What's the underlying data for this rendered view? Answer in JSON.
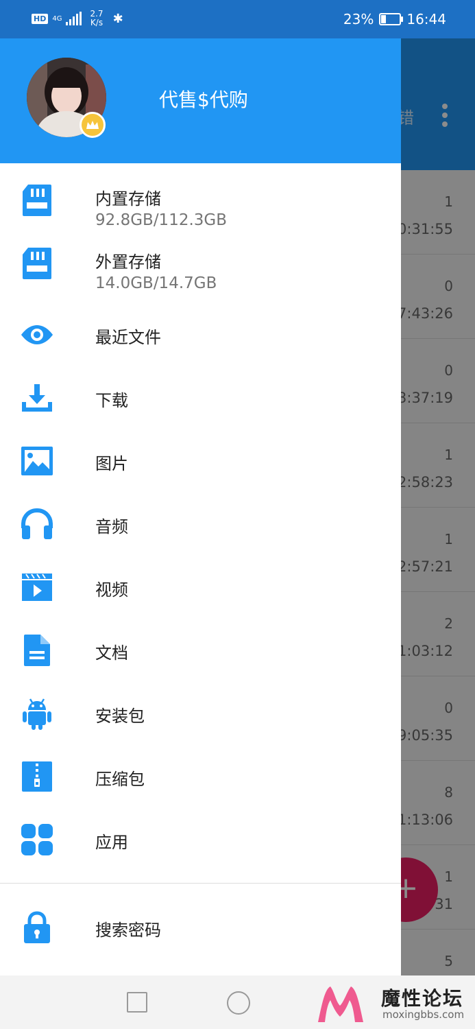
{
  "status_bar": {
    "network": "4G",
    "speed_value": "2.7",
    "speed_unit": "K/s",
    "battery": "23%",
    "battery_level": 0.23,
    "time": "16:44"
  },
  "drawer": {
    "username": "代售$代购",
    "items": [
      {
        "icon": "sd-card-icon",
        "label": "内置存储",
        "sub": "92.8GB/112.3GB"
      },
      {
        "icon": "sd-card-icon",
        "label": "外置存储",
        "sub": "14.0GB/14.7GB"
      },
      {
        "icon": "eye-icon",
        "label": "最近文件"
      },
      {
        "icon": "download-icon",
        "label": "下载"
      },
      {
        "icon": "image-icon",
        "label": "图片"
      },
      {
        "icon": "headphones-icon",
        "label": "音频"
      },
      {
        "icon": "video-icon",
        "label": "视频"
      },
      {
        "icon": "document-icon",
        "label": "文档"
      },
      {
        "icon": "android-icon",
        "label": "安装包"
      },
      {
        "icon": "zip-icon",
        "label": "压缩包"
      },
      {
        "icon": "apps-icon",
        "label": "应用"
      },
      {
        "icon": "lock-icon",
        "label": "搜索密码"
      }
    ]
  },
  "background_list": {
    "partial_search": "错",
    "rows": [
      {
        "count": "1",
        "time": "0:31:55"
      },
      {
        "count": "0",
        "time": "7:43:26"
      },
      {
        "count": "0",
        "time": "3:37:19"
      },
      {
        "count": "1",
        "time": "2:58:23"
      },
      {
        "count": "1",
        "time": "2:57:21"
      },
      {
        "count": "2",
        "time": "1:03:12"
      },
      {
        "count": "0",
        "time": "9:05:35"
      },
      {
        "count": "8",
        "time": "1:13:06"
      },
      {
        "count": "1",
        "time": "31"
      },
      {
        "count": "5",
        "time": ""
      }
    ]
  },
  "watermark": {
    "title": "魔性论坛",
    "url": "moxingbbs.com"
  },
  "colors": {
    "primary": "#2196f3",
    "status_bar": "#1d70c4",
    "fab": "#e91e63"
  }
}
